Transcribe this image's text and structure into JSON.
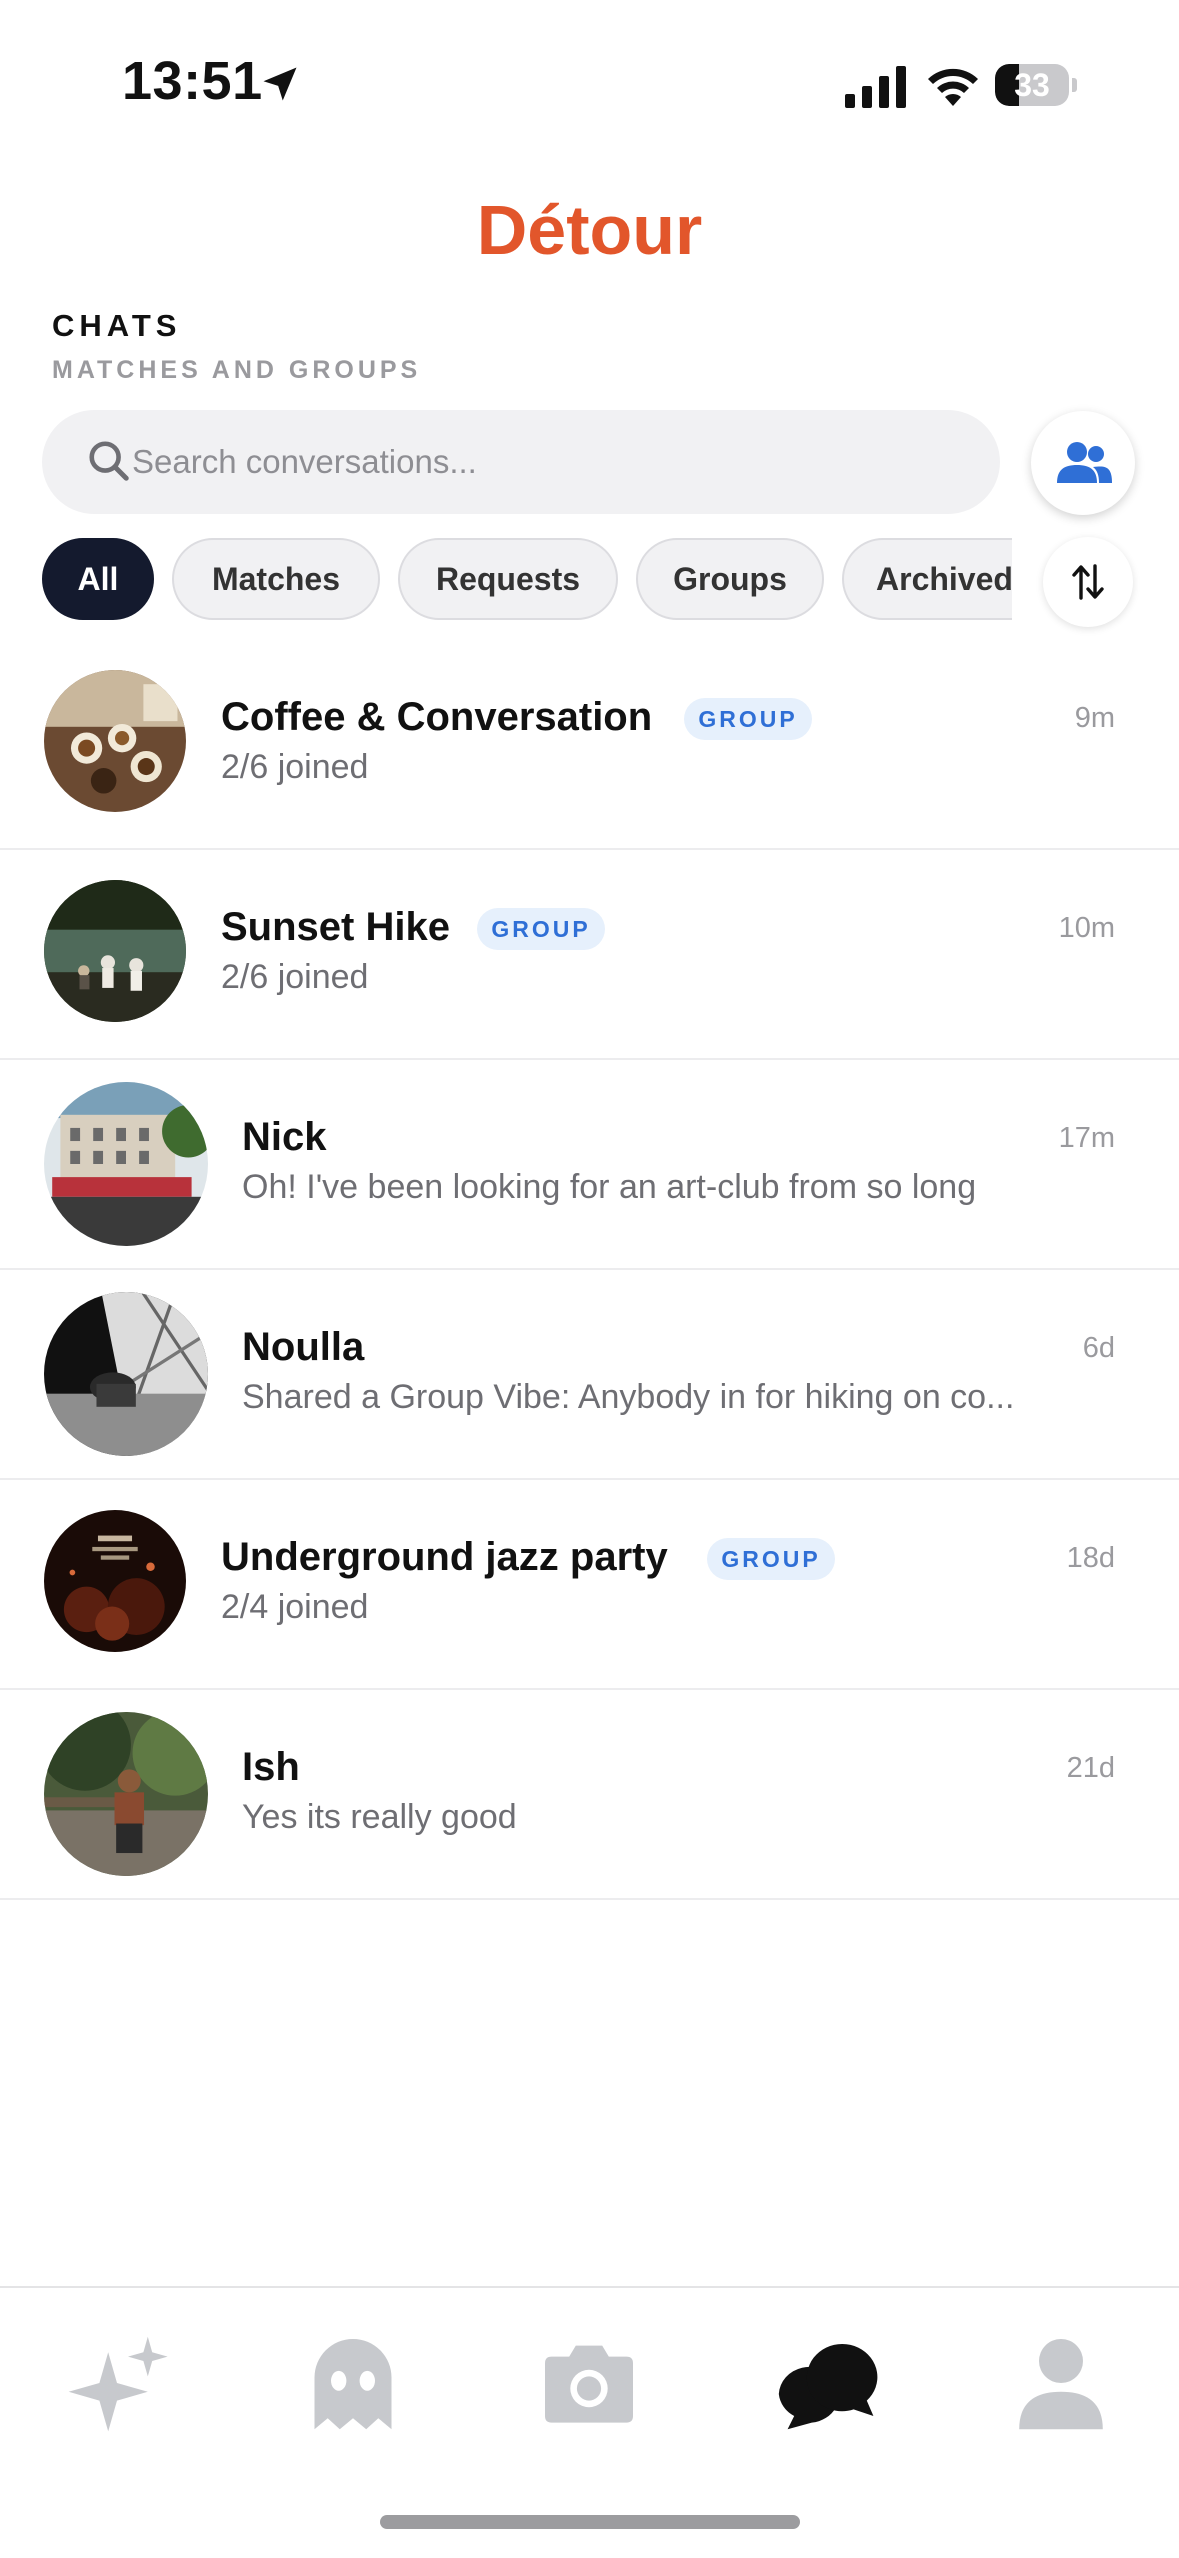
{
  "status_bar": {
    "time": "13:51",
    "battery": "33",
    "battery_level": 0.33
  },
  "app": {
    "title": "Détour",
    "section_title": "CHATS",
    "section_subtitle": "MATCHES AND GROUPS"
  },
  "search": {
    "placeholder": "Search conversations...",
    "value": ""
  },
  "filters": [
    "All",
    "Matches",
    "Requests",
    "Groups",
    "Archived"
  ],
  "active_filter": "All",
  "chats": [
    {
      "name": "Coffee & Conversation",
      "badge": "GROUP",
      "preview": "2/6 joined",
      "time": "9m"
    },
    {
      "name": "Sunset Hike",
      "badge": "GROUP",
      "preview": "2/6 joined",
      "time": "10m"
    },
    {
      "name": "Nick",
      "badge": "",
      "preview": "Oh! I've been looking for an art-club from so long",
      "time": "17m"
    },
    {
      "name": "Noulla",
      "badge": "",
      "preview": "Shared a Group Vibe: Anybody in for hiking on co...",
      "time": "6d"
    },
    {
      "name": "Underground jazz party",
      "badge": "GROUP",
      "preview": "2/4 joined",
      "time": "18d"
    },
    {
      "name": "Ish",
      "badge": "",
      "preview": "Yes its really good",
      "time": "21d"
    }
  ],
  "tab_bar": [
    {
      "icon": "sparkles-icon",
      "active": false
    },
    {
      "icon": "ghost-icon",
      "active": false
    },
    {
      "icon": "camera-icon",
      "active": false
    },
    {
      "icon": "chat-bubbles-icon",
      "active": true
    },
    {
      "icon": "profile-icon",
      "active": false
    }
  ],
  "colors": {
    "brand": "#e2562b",
    "badge_text": "#2f6fd6",
    "badge_bg": "#e6f0fc",
    "chip_active": "#141a2e",
    "tab_inactive": "#c7c9cd",
    "tab_active": "#111111"
  }
}
